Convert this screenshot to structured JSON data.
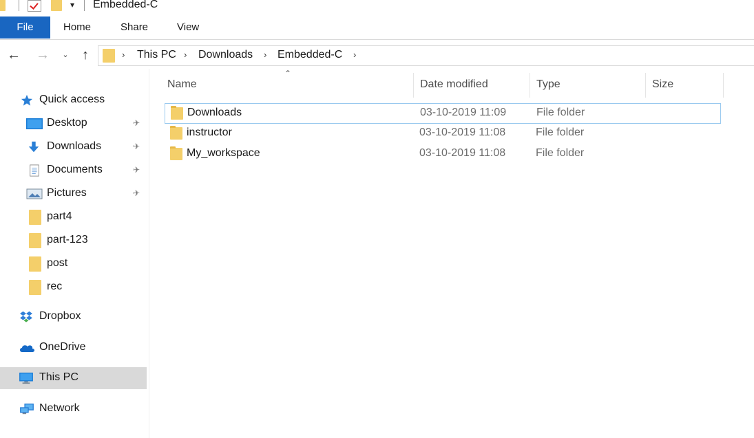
{
  "window": {
    "title": "Embedded-C"
  },
  "ribbon": {
    "tabs": [
      {
        "label": "File"
      },
      {
        "label": "Home"
      },
      {
        "label": "Share"
      },
      {
        "label": "View"
      }
    ]
  },
  "address": {
    "breadcrumbs": [
      "This PC",
      "Downloads",
      "Embedded-C"
    ]
  },
  "navpane": {
    "quick_access": "Quick access",
    "pinned": [
      {
        "label": "Desktop",
        "icon": "desktop-icon"
      },
      {
        "label": "Downloads",
        "icon": "download-icon"
      },
      {
        "label": "Documents",
        "icon": "document-icon"
      },
      {
        "label": "Pictures",
        "icon": "pictures-icon"
      }
    ],
    "folders": [
      {
        "label": "part4"
      },
      {
        "label": "part-123"
      },
      {
        "label": "post"
      },
      {
        "label": "rec"
      }
    ],
    "dropbox": "Dropbox",
    "onedrive": "OneDrive",
    "thispc": "This PC",
    "network": "Network"
  },
  "filelist": {
    "columns": [
      "Name",
      "Date modified",
      "Type",
      "Size"
    ],
    "rows": [
      {
        "name": "Downloads",
        "date": "03-10-2019 11:09",
        "type": "File folder",
        "size": ""
      },
      {
        "name": "instructor",
        "date": "03-10-2019 11:08",
        "type": "File folder",
        "size": ""
      },
      {
        "name": "My_workspace",
        "date": "03-10-2019 11:08",
        "type": "File folder",
        "size": ""
      }
    ]
  },
  "colors": {
    "file_tab": "#1966c1",
    "folder": "#f4cf6a",
    "selection_border": "#99c9ef",
    "nav_selected": "#d9d9d9"
  }
}
